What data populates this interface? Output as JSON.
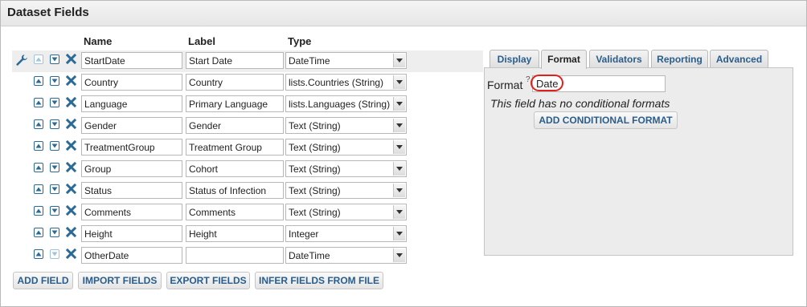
{
  "title": "Dataset Fields",
  "headers": {
    "name": "Name",
    "label": "Label",
    "type": "Type"
  },
  "rows": [
    {
      "name": "StartDate",
      "label": "Start Date",
      "type": "DateTime"
    },
    {
      "name": "Country",
      "label": "Country",
      "type": "lists.Countries (String)"
    },
    {
      "name": "Language",
      "label": "Primary Language",
      "type": "lists.Languages (String)"
    },
    {
      "name": "Gender",
      "label": "Gender",
      "type": "Text (String)"
    },
    {
      "name": "TreatmentGroup",
      "label": "Treatment Group",
      "type": "Text (String)"
    },
    {
      "name": "Group",
      "label": "Cohort",
      "type": "Text (String)"
    },
    {
      "name": "Status",
      "label": "Status of Infection",
      "type": "Text (String)"
    },
    {
      "name": "Comments",
      "label": "Comments",
      "type": "Text (String)"
    },
    {
      "name": "Height",
      "label": "Height",
      "type": "Integer"
    },
    {
      "name": "OtherDate",
      "label": "",
      "type": "DateTime"
    }
  ],
  "buttons": {
    "add_field": "ADD FIELD",
    "import_fields": "IMPORT FIELDS",
    "export_fields": "EXPORT FIELDS",
    "infer_fields": "INFER FIELDS FROM FILE"
  },
  "tabs": [
    "Display",
    "Format",
    "Validators",
    "Reporting",
    "Advanced"
  ],
  "active_tab": "Format",
  "format_panel": {
    "format_label": "Format",
    "help_mark": "?",
    "format_value": "Date",
    "no_conditional": "This field has no conditional formats",
    "add_conditional": "ADD CONDITIONAL FORMAT"
  },
  "colors": {
    "accent": "#2a5d8c",
    "highlight_circle": "#e0211b"
  }
}
